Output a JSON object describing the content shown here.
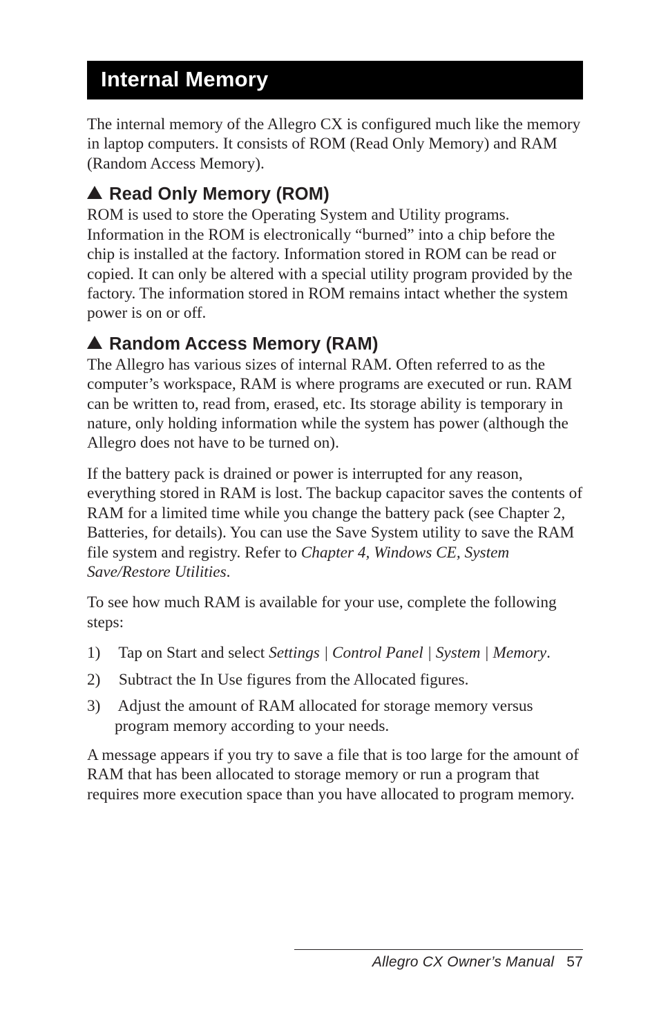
{
  "banner": {
    "title": "Internal Memory"
  },
  "intro": {
    "p1": "The internal memory of the Allegro CX is configured much like the memory in laptop computers. It consists of ROM (Read Only Memory) and RAM (Random Access Memory)."
  },
  "rom": {
    "heading": "Read Only Memory (ROM)",
    "p1": "ROM is used to store the Operating System and Utility programs. Information in the ROM is electronically “burned” into a chip before the chip is installed at the factory. Information stored in ROM can be read or copied. It can only be altered with a special utility program provided by the factory. The information stored in ROM remains intact whether the system power is on or off."
  },
  "ram": {
    "heading": "Random Access Memory (RAM)",
    "p1": "The Allegro has various sizes of internal RAM. Often referred to as the computer’s workspace, RAM is where programs are executed or run. RAM can be written to, read from, erased, etc. Its storage ability is temporary in nature, only holding information while the system has power (although the Allegro does not have to be turned on).",
    "p2a": "If the battery pack is drained or power is interrupted for any reason, everything stored in RAM is lost. The backup capacitor saves the contents of RAM for a limited time while you change the battery pack (see Chapter 2, Batteries, for details). You can use the Save System utility to save the RAM file system and registry. Refer to ",
    "p2_em": "Chapter 4, Windows CE, System Save/Restore Utilities",
    "p2b": ".",
    "p3": "To see how much RAM is available for your use, complete the following steps:",
    "steps": {
      "s1a": "Tap on Start and select ",
      "s1_em": "Settings | Control Panel | System | Memory",
      "s1b": ".",
      "s2": "Subtract the In Use figures from the Allocated figures.",
      "s3": "Adjust the amount of RAM allocated for storage memory versus program memory according to your needs."
    },
    "p4": "A message appears if you try to save a file that is too large for the amount of RAM that has been allocated to storage memory or run a program that requires more execution space than you have allocated to program memory."
  },
  "footer": {
    "title": "Allegro CX Owner’s Manual",
    "page": "57"
  }
}
